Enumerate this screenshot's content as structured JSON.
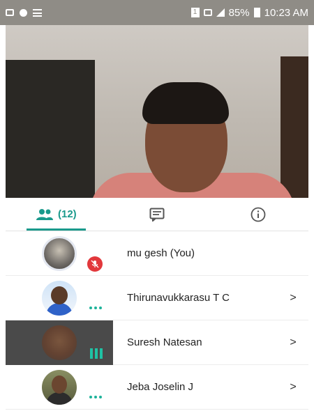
{
  "status_bar": {
    "icons_left": [
      "sd-card-icon",
      "location-pin-icon",
      "list-icon"
    ],
    "icons_right": [
      "sim-1-icon",
      "hd-network-icon",
      "signal-icon"
    ],
    "battery": "85%",
    "time": "10:23 AM"
  },
  "tabs": {
    "people": {
      "icon": "people-icon",
      "count": "(12)"
    },
    "chat": {
      "icon": "chat-icon"
    },
    "info": {
      "icon": "info-icon"
    },
    "accent_color": "#1a9a8c"
  },
  "participants": [
    {
      "name": "mu gesh (You)",
      "status": "muted",
      "status_icon": "mic-muted-icon",
      "has_chevron": false
    },
    {
      "name": "Thirunavukkarasu T C",
      "status": "idle",
      "status_icon": "more-dots-icon",
      "has_chevron": true
    },
    {
      "name": "Suresh Natesan",
      "status": "speaking",
      "status_icon": "audio-level-icon",
      "has_chevron": true
    },
    {
      "name": "Jeba Joselin J",
      "status": "idle",
      "status_icon": "more-dots-icon",
      "has_chevron": true
    }
  ],
  "chevron_glyph": ">",
  "colors": {
    "muted_badge": "#e2383c",
    "speaking": "#1fc2a4"
  }
}
